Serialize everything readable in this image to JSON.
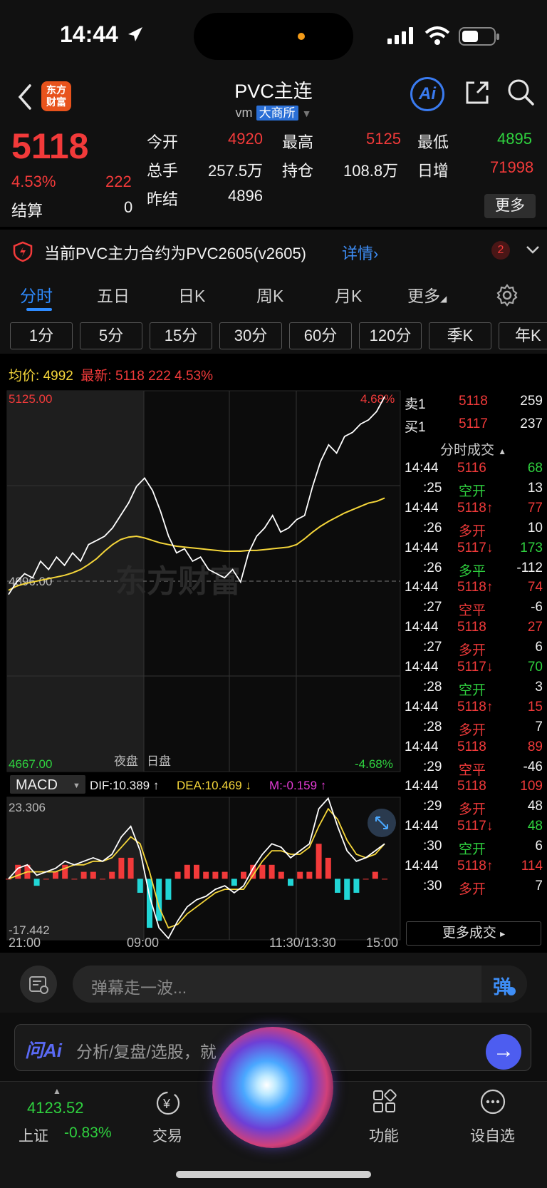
{
  "status_bar": {
    "time": "14:44"
  },
  "nav": {
    "logo_line1": "东方",
    "logo_line2": "财富",
    "title": "PVC主连",
    "subtitle": "vm",
    "exchange": "大商所",
    "ai_label": "Ai"
  },
  "quote": {
    "price": "5118",
    "change_pct": "4.53%",
    "change": "222",
    "settle_label": "结算",
    "settle": "0",
    "open_label": "今开",
    "open": "4920",
    "volume_label": "总手",
    "volume": "257.5万",
    "prev_settle_label": "昨结",
    "prev_settle": "4896",
    "high_label": "最高",
    "high": "5125",
    "oi_label": "持仓",
    "oi": "108.8万",
    "low_label": "最低",
    "low": "4895",
    "daily_inc_label": "日增",
    "daily_inc": "71998",
    "more_label": "更多"
  },
  "notice": {
    "text": "当前PVC主力合约为PVC2605(v2605)",
    "link": "详情",
    "badge": "2"
  },
  "tabs": [
    "分时",
    "五日",
    "日K",
    "周K",
    "月K",
    "更多"
  ],
  "periods": [
    "1分",
    "5分",
    "15分",
    "30分",
    "60分",
    "120分",
    "季K",
    "年K"
  ],
  "info": {
    "avg_label": "均价:",
    "avg": "4992",
    "latest_label": "最新:",
    "latest": "5118",
    "latest_change": "222",
    "latest_pct": "4.53%"
  },
  "chart_data": {
    "type": "line",
    "series": [],
    "price_max_label": "5125.00",
    "price_mid_label": "4896.00",
    "price_min_label": "4667.00",
    "pct_max_label": "4.68%",
    "pct_min_label": "-4.68%",
    "session_night_label": "夜盘",
    "session_day_label": "日盘",
    "watermark": "东方财富",
    "ylim": [
      4667,
      5125
    ],
    "x_ticks": [
      "21:00",
      "09:00",
      "11:30/13:30",
      "15:00"
    ],
    "price": [
      4880,
      4895,
      4905,
      4900,
      4920,
      4910,
      4925,
      4915,
      4930,
      4920,
      4940,
      4945,
      4950,
      4960,
      4975,
      4990,
      5010,
      5020,
      5005,
      4980,
      4950,
      4930,
      4935,
      4920,
      4925,
      4910,
      4905,
      4900,
      4910,
      4895,
      4930,
      4950,
      4960,
      4975,
      4955,
      4960,
      4970,
      4975,
      5010,
      5040,
      5060,
      5050,
      5070,
      5075,
      5085,
      5090,
      5100,
      5118
    ],
    "avg": [
      4885,
      4890,
      4893,
      4895,
      4897,
      4899,
      4901,
      4903,
      4906,
      4910,
      4916,
      4923,
      4932,
      4940,
      4946,
      4949,
      4950,
      4948,
      4945,
      4942,
      4940,
      4938,
      4937,
      4936,
      4935,
      4934,
      4933,
      4932,
      4932,
      4932,
      4933,
      4933,
      4934,
      4935,
      4936,
      4937,
      4940,
      4947,
      4955,
      4962,
      4968,
      4973,
      4978,
      4982,
      4986,
      4990,
      4992,
      4996
    ],
    "macd": {
      "label": "MACD",
      "dif_label": "DIF:10.389 ↑",
      "dea_label": "DEA:10.469 ↓",
      "m_label": "M:-0.159 ↑",
      "max_label": "23.306",
      "min_label": "-17.442",
      "ylim": [
        -17.442,
        23.306
      ],
      "dif": [
        0,
        3,
        4,
        1,
        2,
        3,
        5,
        4,
        5,
        6,
        5,
        7,
        12,
        15,
        8,
        -5,
        -14,
        -17,
        -12,
        -8,
        -6,
        -5,
        -3,
        -2,
        -4,
        -2,
        3,
        7,
        10,
        9,
        6,
        8,
        10,
        20,
        23,
        15,
        8,
        5,
        6,
        8,
        10
      ],
      "dea": [
        0,
        1,
        2,
        2,
        2,
        2,
        3,
        4,
        4,
        5,
        5,
        6,
        9,
        12,
        10,
        2,
        -8,
        -14,
        -13,
        -10,
        -8,
        -6,
        -4,
        -3,
        -3,
        -3,
        1,
        5,
        8,
        8,
        7,
        7,
        9,
        15,
        20,
        17,
        11,
        7,
        6,
        7,
        10
      ]
    }
  },
  "book": {
    "ask_label": "卖1",
    "ask_price": "5118",
    "ask_vol": "259",
    "bid_label": "买1",
    "bid_price": "5117",
    "bid_vol": "237",
    "deals_title": "分时成交",
    "more_deals": "更多成交",
    "rows": [
      {
        "t": "14:44",
        "p": "5116",
        "v": "68",
        "pc": "red",
        "vc": "green"
      },
      {
        "t": ":25",
        "p": "空开",
        "v": "13",
        "pc": "green",
        "vc": "white"
      },
      {
        "t": "14:44",
        "p": "5118↑",
        "v": "77",
        "pc": "red",
        "vc": "red"
      },
      {
        "t": ":26",
        "p": "多开",
        "v": "10",
        "pc": "red",
        "vc": "white"
      },
      {
        "t": "14:44",
        "p": "5117↓",
        "v": "173",
        "pc": "red",
        "vc": "green"
      },
      {
        "t": ":26",
        "p": "多平",
        "v": "-112",
        "pc": "green",
        "vc": "white"
      },
      {
        "t": "14:44",
        "p": "5118↑",
        "v": "74",
        "pc": "red",
        "vc": "red"
      },
      {
        "t": ":27",
        "p": "空平",
        "v": "-6",
        "pc": "red",
        "vc": "white"
      },
      {
        "t": "14:44",
        "p": "5118",
        "v": "27",
        "pc": "red",
        "vc": "red"
      },
      {
        "t": ":27",
        "p": "多开",
        "v": "6",
        "pc": "red",
        "vc": "white"
      },
      {
        "t": "14:44",
        "p": "5117↓",
        "v": "70",
        "pc": "red",
        "vc": "green"
      },
      {
        "t": ":28",
        "p": "空开",
        "v": "3",
        "pc": "green",
        "vc": "white"
      },
      {
        "t": "14:44",
        "p": "5118↑",
        "v": "15",
        "pc": "red",
        "vc": "red"
      },
      {
        "t": ":28",
        "p": "多开",
        "v": "7",
        "pc": "red",
        "vc": "white"
      },
      {
        "t": "14:44",
        "p": "5118",
        "v": "89",
        "pc": "red",
        "vc": "red"
      },
      {
        "t": ":29",
        "p": "空平",
        "v": "-46",
        "pc": "red",
        "vc": "white"
      },
      {
        "t": "14:44",
        "p": "5118",
        "v": "109",
        "pc": "red",
        "vc": "red"
      },
      {
        "t": ":29",
        "p": "多开",
        "v": "48",
        "pc": "red",
        "vc": "white"
      },
      {
        "t": "14:44",
        "p": "5117↓",
        "v": "48",
        "pc": "red",
        "vc": "green"
      },
      {
        "t": ":30",
        "p": "空开",
        "v": "6",
        "pc": "green",
        "vc": "white"
      },
      {
        "t": "14:44",
        "p": "5118↑",
        "v": "114",
        "pc": "red",
        "vc": "red"
      },
      {
        "t": ":30",
        "p": "多开",
        "v": "7",
        "pc": "red",
        "vc": "white"
      }
    ]
  },
  "danmu": {
    "placeholder": "弹幕走一波...",
    "button": "弹"
  },
  "ai_bar": {
    "brand": "问Ai",
    "placeholder": "分析/复盘/选股，就"
  },
  "tabbar": {
    "index_value": "4123.52",
    "index_name": "上证",
    "index_pct": "-0.83%",
    "trade": "交易",
    "features": "功能",
    "watchlist": "设自选"
  },
  "colors": {
    "up": "#f23a3a",
    "down": "#2fd23f",
    "avg_line": "#f5d63a",
    "accent": "#2e8bff",
    "macd_neg": "#21d6d6"
  }
}
